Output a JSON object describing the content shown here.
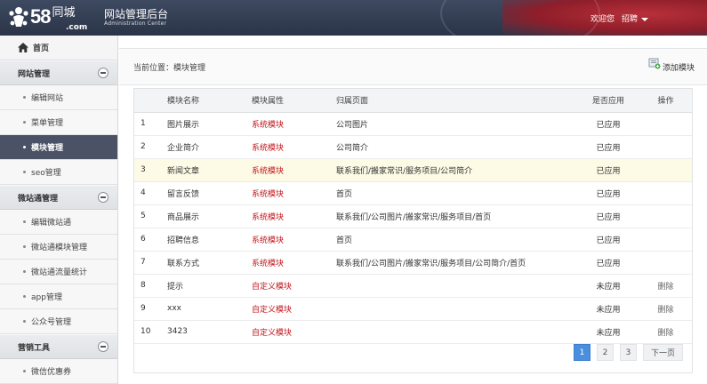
{
  "header": {
    "logo_number": "58",
    "logo_cn": "同城",
    "logo_domain": ".com",
    "title": "网站管理后台",
    "subtitle": "Administration Center",
    "welcome": "欢迎您",
    "user_menu": "招聘"
  },
  "sidebar": {
    "home": "首页",
    "groups": [
      {
        "label": "网站管理",
        "items": [
          "编辑网站",
          "菜单管理",
          "模块管理",
          "seo管理"
        ]
      },
      {
        "label": "微站通管理",
        "items": [
          "编辑微站通",
          "微站通模块管理",
          "微站通流量统计",
          "app管理",
          "公众号管理"
        ]
      },
      {
        "label": "营销工具",
        "items": [
          "微信优惠券"
        ]
      }
    ],
    "active_item": "模块管理"
  },
  "main": {
    "breadcrumb": "当前位置：模块管理",
    "add_button": "添加模块",
    "table": {
      "headers": [
        "",
        "模块名称",
        "模块属性",
        "归属页面",
        "是否应用",
        "操作"
      ],
      "rows": [
        [
          "1",
          "图片展示",
          "系统模块",
          "公司图片",
          "已应用",
          ""
        ],
        [
          "2",
          "企业简介",
          "系统模块",
          "公司简介",
          "已应用",
          ""
        ],
        [
          "3",
          "新闻文章",
          "系统模块",
          "联系我们/搬家常识/服务项目/公司简介",
          "已应用",
          ""
        ],
        [
          "4",
          "留言反馈",
          "系统模块",
          "首页",
          "已应用",
          ""
        ],
        [
          "5",
          "商品展示",
          "系统模块",
          "联系我们/公司图片/搬家常识/服务项目/首页",
          "已应用",
          ""
        ],
        [
          "6",
          "招聘信息",
          "系统模块",
          "首页",
          "已应用",
          ""
        ],
        [
          "7",
          "联系方式",
          "系统模块",
          "联系我们/公司图片/搬家常识/服务项目/公司简介/首页",
          "已应用",
          ""
        ],
        [
          "8",
          "提示",
          "自定义模块",
          "",
          "未应用",
          "删除"
        ],
        [
          "9",
          "xxx",
          "自定义模块",
          "",
          "未应用",
          "删除"
        ],
        [
          "10",
          "3423",
          "自定义模块",
          "",
          "未应用",
          "删除"
        ]
      ],
      "highlighted_row": 3
    },
    "pagination": {
      "pages": [
        "1",
        "2",
        "3"
      ],
      "current": "1",
      "next": "下一页"
    }
  },
  "colors": {
    "header_bg": "#2f384b",
    "sidebar_active": "#4b5265",
    "attribute_red": "#c1161c",
    "pager_current": "#4a8fde",
    "row_highlight": "#fdfbe6"
  }
}
